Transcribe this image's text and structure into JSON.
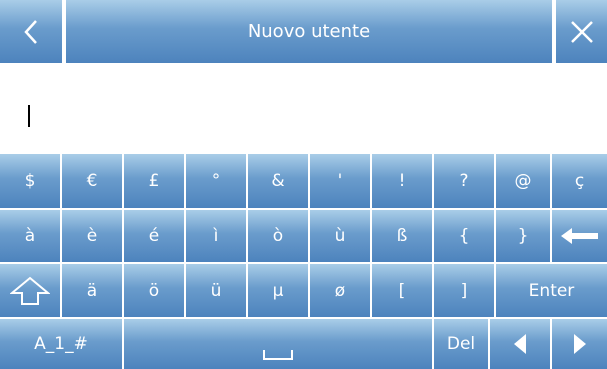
{
  "header": {
    "title": "Nuovo utente"
  },
  "input": {
    "value": ""
  },
  "keyboard": {
    "row1": [
      "$",
      "€",
      "£",
      "°",
      "&",
      "'",
      "!",
      "?",
      "@",
      "ç"
    ],
    "row2": [
      "à",
      "è",
      "é",
      "ì",
      "ò",
      "ù",
      "ß",
      "{",
      "}"
    ],
    "row3": [
      "ä",
      "ö",
      "ü",
      "µ",
      "ø",
      "[",
      "]"
    ],
    "enter_label": "Enter",
    "mode_label": "A_1_#",
    "del_label": "Del"
  }
}
